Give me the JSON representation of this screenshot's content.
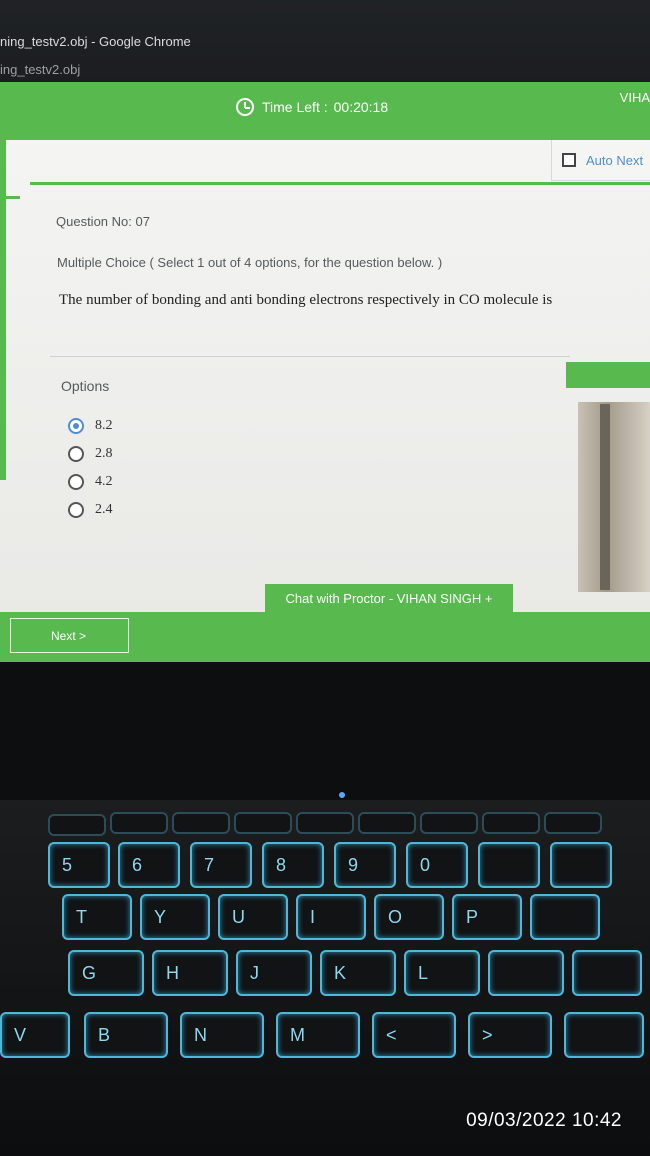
{
  "window": {
    "title": "ning_testv2.obj - Google Chrome",
    "url_title": "ing_testv2.obj"
  },
  "header": {
    "timer_label": "Time Left :",
    "timer_value": "00:20:18",
    "user": "VIHA"
  },
  "auto_next": {
    "label": "Auto Next",
    "checked": false
  },
  "question": {
    "number": "Question No: 07",
    "type": "Multiple Choice ( Select 1 out of 4 options, for the question below. )",
    "text": "The number of bonding and anti bonding electrons respectively in CO molecule is",
    "options_label": "Options",
    "options": [
      {
        "text": "8.2",
        "selected": true
      },
      {
        "text": "2.8",
        "selected": false
      },
      {
        "text": "4.2",
        "selected": false
      },
      {
        "text": "2.4",
        "selected": false
      }
    ]
  },
  "chat": {
    "label": "Chat with Proctor - VIHAN SINGH  +"
  },
  "footer": {
    "next_label": "Next >"
  },
  "keyboard": {
    "row1": [
      "5",
      "6",
      "7",
      "8",
      "9",
      "0"
    ],
    "row2": [
      "T",
      "Y",
      "U",
      "I",
      "O",
      "P"
    ],
    "row3": [
      "G",
      "H",
      "J",
      "K",
      "L"
    ],
    "row4": [
      "V",
      "B",
      "N",
      "M",
      "<",
      ">"
    ]
  },
  "timestamp": "09/03/2022 10:42",
  "colors": {
    "accent_green": "#58b94e",
    "link_blue": "#4f8ecf",
    "key_glow": "#4fb8d8"
  }
}
